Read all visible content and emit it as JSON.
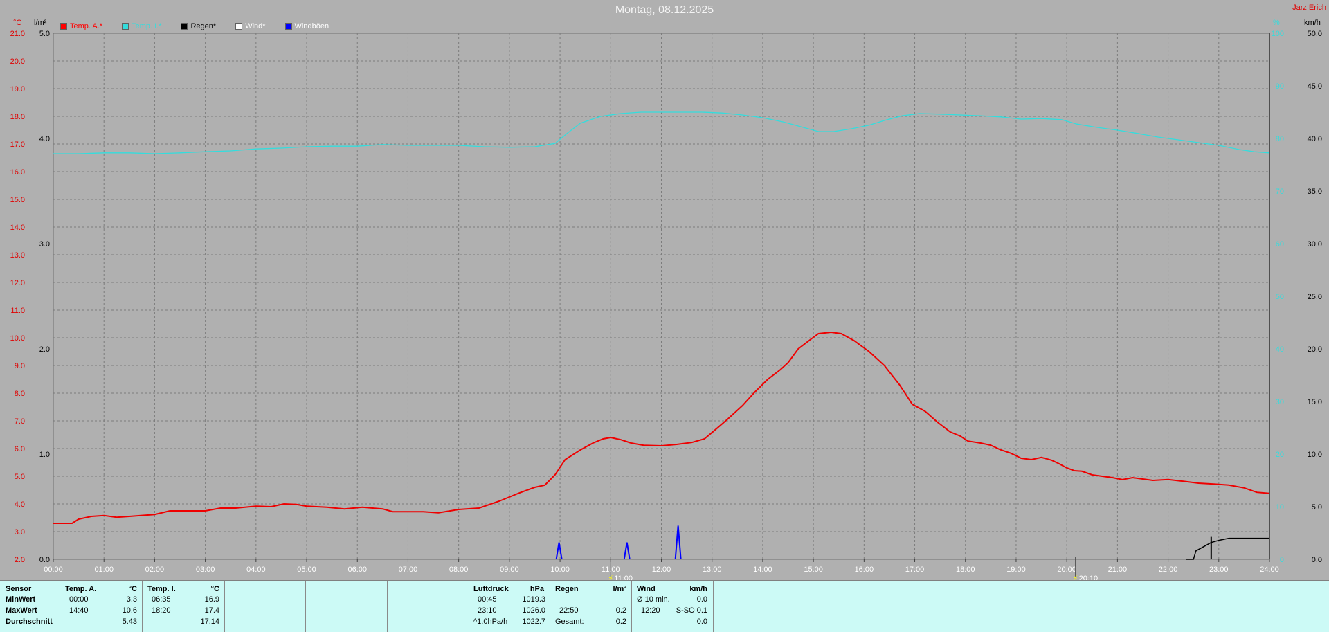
{
  "header": {
    "title": "Montag, 08.12.2025",
    "station_name": "Jarz Erich",
    "unit_temp": "°C",
    "unit_rain": "l/m²",
    "unit_hum": "%",
    "unit_wind": "km/h"
  },
  "legend": [
    {
      "label": "Temp. A.*",
      "color": "#ff0000",
      "text_color": "#ff0000"
    },
    {
      "label": "Temp. I.*",
      "color": "#33dddd",
      "text_color": "#33dddd"
    },
    {
      "label": "Regen*",
      "color": "#000000",
      "text_color": "#000000"
    },
    {
      "label": "Wind*",
      "color": "#ffffff",
      "text_color": "#ffffff"
    },
    {
      "label": "Windböen",
      "color": "#0000ff",
      "text_color": "#ffffff"
    }
  ],
  "chart_data": {
    "type": "line",
    "title": "Montag, 08.12.2025",
    "x_ticks": [
      "00:00",
      "01:00",
      "02:00",
      "03:00",
      "04:00",
      "05:00",
      "06:00",
      "07:00",
      "08:00",
      "09:00",
      "10:00",
      "11:00",
      "12:00",
      "13:00",
      "14:00",
      "15:00",
      "16:00",
      "17:00",
      "18:00",
      "19:00",
      "20:00",
      "21:00",
      "22:00",
      "23:00",
      "24:00"
    ],
    "x_range_hours": [
      0,
      24
    ],
    "y_left_temp": {
      "min": 2.0,
      "max": 21.0,
      "ticks": [
        "2.0",
        "3.0",
        "4.0",
        "5.0",
        "6.0",
        "7.0",
        "8.0",
        "9.0",
        "10.0",
        "11.0",
        "12.0",
        "13.0",
        "14.0",
        "15.0",
        "16.0",
        "17.0",
        "18.0",
        "19.0",
        "20.0",
        "21.0"
      ]
    },
    "y_left_rain": {
      "min": 0.0,
      "max": 5.0,
      "ticks": [
        "0.0",
        "1.0",
        "2.0",
        "3.0",
        "4.0",
        "5.0"
      ]
    },
    "y_right_wind": {
      "min": 0.0,
      "max": 50.0,
      "ticks": [
        "0.0",
        "5.0",
        "10.0",
        "15.0",
        "20.0",
        "25.0",
        "30.0",
        "35.0",
        "40.0",
        "45.0",
        "50.0"
      ]
    },
    "y_right_hum": {
      "min": 0,
      "max": 100,
      "ticks": [
        "0",
        "10",
        "20",
        "30",
        "40",
        "50",
        "60",
        "70",
        "80",
        "90",
        "100"
      ]
    },
    "grid": true,
    "series": [
      {
        "name": "Temp. A.*",
        "color": "#ee0000",
        "axis": "temp",
        "points": [
          [
            0,
            3.3
          ],
          [
            0.37,
            3.3
          ],
          [
            0.5,
            3.45
          ],
          [
            0.75,
            3.55
          ],
          [
            1.0,
            3.58
          ],
          [
            1.25,
            3.52
          ],
          [
            1.5,
            3.55
          ],
          [
            2.0,
            3.62
          ],
          [
            2.3,
            3.75
          ],
          [
            2.6,
            3.75
          ],
          [
            3.0,
            3.75
          ],
          [
            3.3,
            3.85
          ],
          [
            3.6,
            3.85
          ],
          [
            4.0,
            3.92
          ],
          [
            4.3,
            3.9
          ],
          [
            4.55,
            4.0
          ],
          [
            4.8,
            3.98
          ],
          [
            5.0,
            3.92
          ],
          [
            5.4,
            3.88
          ],
          [
            5.75,
            3.82
          ],
          [
            6.1,
            3.88
          ],
          [
            6.5,
            3.82
          ],
          [
            6.7,
            3.72
          ],
          [
            7.0,
            3.72
          ],
          [
            7.3,
            3.72
          ],
          [
            7.6,
            3.68
          ],
          [
            8.0,
            3.8
          ],
          [
            8.4,
            3.85
          ],
          [
            8.8,
            4.1
          ],
          [
            9.2,
            4.4
          ],
          [
            9.5,
            4.6
          ],
          [
            9.7,
            4.68
          ],
          [
            9.9,
            5.05
          ],
          [
            10.1,
            5.6
          ],
          [
            10.4,
            5.95
          ],
          [
            10.65,
            6.2
          ],
          [
            10.85,
            6.35
          ],
          [
            11.0,
            6.4
          ],
          [
            11.2,
            6.32
          ],
          [
            11.4,
            6.2
          ],
          [
            11.65,
            6.12
          ],
          [
            12.0,
            6.1
          ],
          [
            12.3,
            6.15
          ],
          [
            12.6,
            6.22
          ],
          [
            12.85,
            6.35
          ],
          [
            13.0,
            6.58
          ],
          [
            13.3,
            7.05
          ],
          [
            13.6,
            7.55
          ],
          [
            13.85,
            8.05
          ],
          [
            14.1,
            8.5
          ],
          [
            14.35,
            8.85
          ],
          [
            14.5,
            9.1
          ],
          [
            14.7,
            9.6
          ],
          [
            14.95,
            9.95
          ],
          [
            15.1,
            10.15
          ],
          [
            15.35,
            10.2
          ],
          [
            15.55,
            10.15
          ],
          [
            15.8,
            9.9
          ],
          [
            16.1,
            9.5
          ],
          [
            16.4,
            9.0
          ],
          [
            16.7,
            8.3
          ],
          [
            16.95,
            7.6
          ],
          [
            17.2,
            7.35
          ],
          [
            17.45,
            6.95
          ],
          [
            17.7,
            6.6
          ],
          [
            17.9,
            6.45
          ],
          [
            18.05,
            6.27
          ],
          [
            18.3,
            6.2
          ],
          [
            18.5,
            6.12
          ],
          [
            18.7,
            5.95
          ],
          [
            18.9,
            5.83
          ],
          [
            19.1,
            5.65
          ],
          [
            19.3,
            5.6
          ],
          [
            19.5,
            5.68
          ],
          [
            19.7,
            5.58
          ],
          [
            19.85,
            5.45
          ],
          [
            20.0,
            5.3
          ],
          [
            20.15,
            5.2
          ],
          [
            20.3,
            5.18
          ],
          [
            20.5,
            5.05
          ],
          [
            20.7,
            5.0
          ],
          [
            20.9,
            4.95
          ],
          [
            21.1,
            4.88
          ],
          [
            21.3,
            4.95
          ],
          [
            21.5,
            4.9
          ],
          [
            21.7,
            4.85
          ],
          [
            22.0,
            4.88
          ],
          [
            22.3,
            4.82
          ],
          [
            22.6,
            4.75
          ],
          [
            22.9,
            4.72
          ],
          [
            23.2,
            4.68
          ],
          [
            23.5,
            4.58
          ],
          [
            23.75,
            4.42
          ],
          [
            24.0,
            4.38
          ]
        ]
      },
      {
        "name": "Temp. I.*",
        "color": "#33dddd",
        "axis": "temp",
        "points": [
          [
            0,
            16.65
          ],
          [
            0.5,
            16.65
          ],
          [
            1.0,
            16.68
          ],
          [
            1.5,
            16.68
          ],
          [
            2.0,
            16.65
          ],
          [
            2.5,
            16.68
          ],
          [
            3.0,
            16.72
          ],
          [
            3.5,
            16.75
          ],
          [
            4.0,
            16.82
          ],
          [
            4.5,
            16.85
          ],
          [
            5.0,
            16.9
          ],
          [
            5.5,
            16.92
          ],
          [
            6.0,
            16.92
          ],
          [
            6.5,
            16.98
          ],
          [
            7.0,
            16.95
          ],
          [
            7.5,
            16.95
          ],
          [
            8.0,
            16.95
          ],
          [
            8.5,
            16.9
          ],
          [
            9.0,
            16.88
          ],
          [
            9.5,
            16.9
          ],
          [
            9.9,
            17.02
          ],
          [
            10.15,
            17.4
          ],
          [
            10.4,
            17.75
          ],
          [
            10.8,
            18.0
          ],
          [
            11.2,
            18.1
          ],
          [
            11.6,
            18.15
          ],
          [
            12.0,
            18.15
          ],
          [
            12.4,
            18.15
          ],
          [
            12.8,
            18.15
          ],
          [
            13.2,
            18.12
          ],
          [
            13.6,
            18.05
          ],
          [
            14.0,
            17.95
          ],
          [
            14.4,
            17.8
          ],
          [
            14.8,
            17.6
          ],
          [
            15.1,
            17.45
          ],
          [
            15.4,
            17.45
          ],
          [
            15.75,
            17.55
          ],
          [
            16.1,
            17.68
          ],
          [
            16.4,
            17.85
          ],
          [
            16.75,
            18.02
          ],
          [
            17.1,
            18.1
          ],
          [
            17.5,
            18.08
          ],
          [
            17.9,
            18.05
          ],
          [
            18.3,
            18.02
          ],
          [
            18.7,
            17.98
          ],
          [
            19.1,
            17.9
          ],
          [
            19.5,
            17.92
          ],
          [
            19.9,
            17.88
          ],
          [
            20.2,
            17.72
          ],
          [
            20.6,
            17.6
          ],
          [
            21.0,
            17.5
          ],
          [
            21.4,
            17.38
          ],
          [
            21.8,
            17.25
          ],
          [
            22.2,
            17.15
          ],
          [
            22.6,
            17.05
          ],
          [
            23.0,
            16.95
          ],
          [
            23.4,
            16.8
          ],
          [
            23.7,
            16.72
          ],
          [
            24.0,
            16.68
          ]
        ]
      },
      {
        "name": "Regen*",
        "color": "#000000",
        "axis": "rain",
        "points": [
          [
            22.35,
            0.0
          ],
          [
            22.5,
            0.0
          ],
          [
            22.55,
            0.08
          ],
          [
            22.7,
            0.12
          ],
          [
            22.85,
            0.16
          ],
          [
            23.0,
            0.18
          ],
          [
            23.2,
            0.2
          ],
          [
            23.5,
            0.2
          ],
          [
            23.8,
            0.2
          ],
          [
            24.0,
            0.2
          ]
        ],
        "spike": [
          22.85,
          0.2
        ]
      },
      {
        "name": "Windböen",
        "color": "#0000ff",
        "axis": "wind",
        "spikes": [
          [
            9.98,
            1.6
          ],
          [
            11.32,
            1.6
          ],
          [
            12.33,
            3.2
          ]
        ]
      }
    ],
    "markers": [
      {
        "x": 11.0,
        "label": "11:00"
      },
      {
        "x": 20.17,
        "label": "20:10"
      }
    ]
  },
  "stats": {
    "sensor": {
      "header": "Sensor",
      "rows": [
        "MinWert",
        "MaxWert",
        "Durchschnitt"
      ]
    },
    "temp_a": {
      "header": "Temp. A.",
      "unit": "°C",
      "min_time": "00:00",
      "min_val": "3.3",
      "max_time": "14:40",
      "max_val": "10.6",
      "avg_val": "5.43"
    },
    "temp_i": {
      "header": "Temp. I.",
      "unit": "°C",
      "min_time": "06:35",
      "min_val": "16.9",
      "max_time": "18:20",
      "max_val": "17.4",
      "avg_val": "17.14"
    },
    "pressure": {
      "header": "Luftdruck",
      "unit": "hPa",
      "min_time": "00:45",
      "min_val": "1019.3",
      "max_time": "23:10",
      "max_val": "1026.0",
      "avg_label": "^1.0hPa/h",
      "avg_val": "1022.7"
    },
    "rain": {
      "header": "Regen",
      "unit": "l/m²",
      "max_time": "22:50",
      "max_val": "0.2",
      "total_label": "Gesamt:",
      "total_val": "0.2"
    },
    "wind": {
      "header": "Wind",
      "unit": "km/h",
      "avg10_label": "Ø 10 min.",
      "avg10_val": "0.0",
      "max_time": "12:20",
      "max_dir_val": "S-SO 0.1",
      "avg_val": "0.0"
    }
  }
}
